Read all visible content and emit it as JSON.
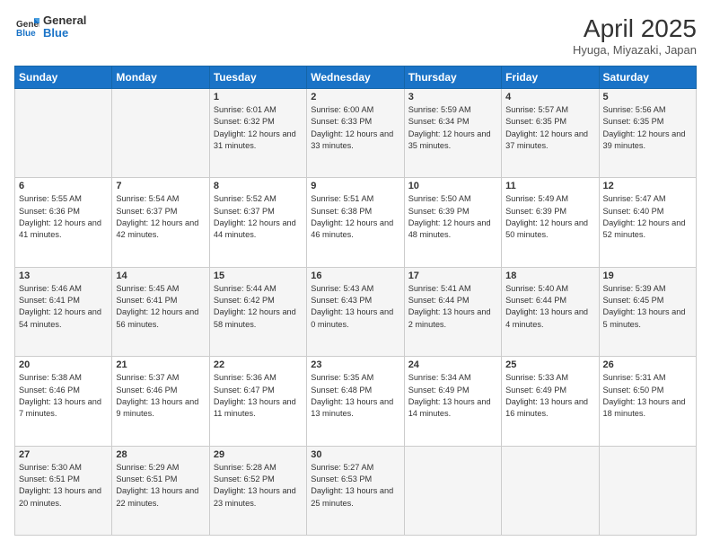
{
  "header": {
    "logo_line1": "General",
    "logo_line2": "Blue",
    "title": "April 2025",
    "subtitle": "Hyuga, Miyazaki, Japan"
  },
  "weekdays": [
    "Sunday",
    "Monday",
    "Tuesday",
    "Wednesday",
    "Thursday",
    "Friday",
    "Saturday"
  ],
  "weeks": [
    [
      {
        "day": "",
        "info": ""
      },
      {
        "day": "",
        "info": ""
      },
      {
        "day": "1",
        "info": "Sunrise: 6:01 AM\nSunset: 6:32 PM\nDaylight: 12 hours and 31 minutes."
      },
      {
        "day": "2",
        "info": "Sunrise: 6:00 AM\nSunset: 6:33 PM\nDaylight: 12 hours and 33 minutes."
      },
      {
        "day": "3",
        "info": "Sunrise: 5:59 AM\nSunset: 6:34 PM\nDaylight: 12 hours and 35 minutes."
      },
      {
        "day": "4",
        "info": "Sunrise: 5:57 AM\nSunset: 6:35 PM\nDaylight: 12 hours and 37 minutes."
      },
      {
        "day": "5",
        "info": "Sunrise: 5:56 AM\nSunset: 6:35 PM\nDaylight: 12 hours and 39 minutes."
      }
    ],
    [
      {
        "day": "6",
        "info": "Sunrise: 5:55 AM\nSunset: 6:36 PM\nDaylight: 12 hours and 41 minutes."
      },
      {
        "day": "7",
        "info": "Sunrise: 5:54 AM\nSunset: 6:37 PM\nDaylight: 12 hours and 42 minutes."
      },
      {
        "day": "8",
        "info": "Sunrise: 5:52 AM\nSunset: 6:37 PM\nDaylight: 12 hours and 44 minutes."
      },
      {
        "day": "9",
        "info": "Sunrise: 5:51 AM\nSunset: 6:38 PM\nDaylight: 12 hours and 46 minutes."
      },
      {
        "day": "10",
        "info": "Sunrise: 5:50 AM\nSunset: 6:39 PM\nDaylight: 12 hours and 48 minutes."
      },
      {
        "day": "11",
        "info": "Sunrise: 5:49 AM\nSunset: 6:39 PM\nDaylight: 12 hours and 50 minutes."
      },
      {
        "day": "12",
        "info": "Sunrise: 5:47 AM\nSunset: 6:40 PM\nDaylight: 12 hours and 52 minutes."
      }
    ],
    [
      {
        "day": "13",
        "info": "Sunrise: 5:46 AM\nSunset: 6:41 PM\nDaylight: 12 hours and 54 minutes."
      },
      {
        "day": "14",
        "info": "Sunrise: 5:45 AM\nSunset: 6:41 PM\nDaylight: 12 hours and 56 minutes."
      },
      {
        "day": "15",
        "info": "Sunrise: 5:44 AM\nSunset: 6:42 PM\nDaylight: 12 hours and 58 minutes."
      },
      {
        "day": "16",
        "info": "Sunrise: 5:43 AM\nSunset: 6:43 PM\nDaylight: 13 hours and 0 minutes."
      },
      {
        "day": "17",
        "info": "Sunrise: 5:41 AM\nSunset: 6:44 PM\nDaylight: 13 hours and 2 minutes."
      },
      {
        "day": "18",
        "info": "Sunrise: 5:40 AM\nSunset: 6:44 PM\nDaylight: 13 hours and 4 minutes."
      },
      {
        "day": "19",
        "info": "Sunrise: 5:39 AM\nSunset: 6:45 PM\nDaylight: 13 hours and 5 minutes."
      }
    ],
    [
      {
        "day": "20",
        "info": "Sunrise: 5:38 AM\nSunset: 6:46 PM\nDaylight: 13 hours and 7 minutes."
      },
      {
        "day": "21",
        "info": "Sunrise: 5:37 AM\nSunset: 6:46 PM\nDaylight: 13 hours and 9 minutes."
      },
      {
        "day": "22",
        "info": "Sunrise: 5:36 AM\nSunset: 6:47 PM\nDaylight: 13 hours and 11 minutes."
      },
      {
        "day": "23",
        "info": "Sunrise: 5:35 AM\nSunset: 6:48 PM\nDaylight: 13 hours and 13 minutes."
      },
      {
        "day": "24",
        "info": "Sunrise: 5:34 AM\nSunset: 6:49 PM\nDaylight: 13 hours and 14 minutes."
      },
      {
        "day": "25",
        "info": "Sunrise: 5:33 AM\nSunset: 6:49 PM\nDaylight: 13 hours and 16 minutes."
      },
      {
        "day": "26",
        "info": "Sunrise: 5:31 AM\nSunset: 6:50 PM\nDaylight: 13 hours and 18 minutes."
      }
    ],
    [
      {
        "day": "27",
        "info": "Sunrise: 5:30 AM\nSunset: 6:51 PM\nDaylight: 13 hours and 20 minutes."
      },
      {
        "day": "28",
        "info": "Sunrise: 5:29 AM\nSunset: 6:51 PM\nDaylight: 13 hours and 22 minutes."
      },
      {
        "day": "29",
        "info": "Sunrise: 5:28 AM\nSunset: 6:52 PM\nDaylight: 13 hours and 23 minutes."
      },
      {
        "day": "30",
        "info": "Sunrise: 5:27 AM\nSunset: 6:53 PM\nDaylight: 13 hours and 25 minutes."
      },
      {
        "day": "",
        "info": ""
      },
      {
        "day": "",
        "info": ""
      },
      {
        "day": "",
        "info": ""
      }
    ]
  ]
}
